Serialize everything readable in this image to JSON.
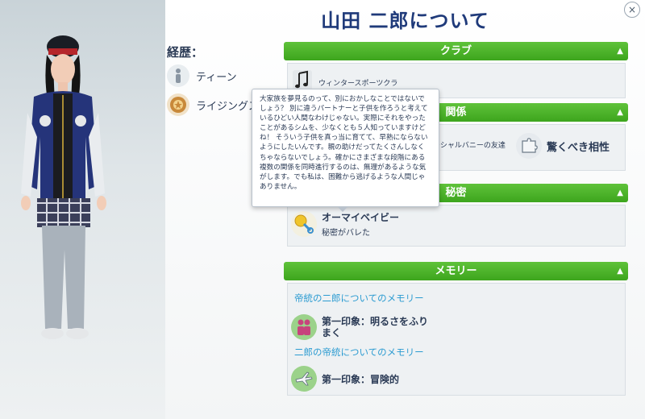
{
  "title": "山田 二郎について",
  "history": {
    "label": "経歴：",
    "items": [
      {
        "label": "ティーン",
        "icon": "teen-icon"
      },
      {
        "label": "ライジングス",
        "icon": "rising-star-icon"
      }
    ]
  },
  "sections": {
    "club": {
      "header": "クラブ",
      "item": "ウィンタースポーツクラ"
    },
    "relations": {
      "header": "関係",
      "item": "ーシャルバニーの友達",
      "trait": "驚くべき相性"
    },
    "secret": {
      "header": "秘密",
      "name": "オーマイベイビー",
      "status": "秘密がバレた"
    },
    "memory": {
      "header": "メモリー",
      "link1": "帝統の二郎についてのメモリー",
      "item1": "第一印象：明るさをふり\nまく",
      "link2": "二郎の帝統についてのメモリー",
      "item2": "第一印象：冒険的"
    }
  },
  "tooltip": {
    "text": "大家族を夢見るのって、別におかしなことではないでしょう？ 別に違うパートナーと子供を作ろうと考えているひどい人間なわけじゃない。実際にそれをやったことがあるシムを、少なくとも５人知っていますけどね！ そういう子供を真っ当に育てて、早熟にならないようにしたいんです。親の助けだってたくさんしなくちゃならないでしょう。確かにさまざまな段階にある複数の関係を同時進行するのは、無理があるような気がします。でも私は、困難から逃げるような人間じゃありません。"
  },
  "close_label": "×",
  "colors": {
    "section_header": "#4bb52a",
    "link": "#2b9bd1",
    "title": "#1f3a7a"
  }
}
